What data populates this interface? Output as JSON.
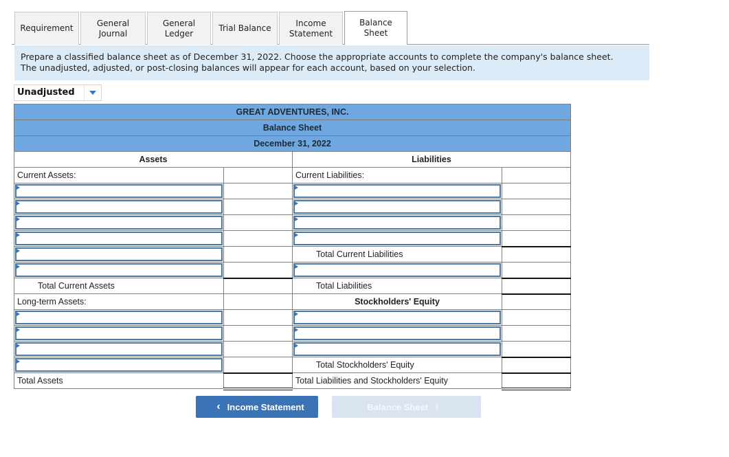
{
  "tabs": [
    {
      "label": "Requirement",
      "active": false
    },
    {
      "label": "General\nJournal",
      "active": false
    },
    {
      "label": "General\nLedger",
      "active": false
    },
    {
      "label": "Trial Balance",
      "active": false
    },
    {
      "label": "Income\nStatement",
      "active": false
    },
    {
      "label": "Balance Sheet",
      "active": true
    }
  ],
  "instructions": {
    "line1": "Prepare a classified balance sheet as of December 31, 2022. Choose the appropriate accounts to complete the company's balance sheet.",
    "line2": "The unadjusted, adjusted, or post-closing balances will appear for each account, based on your selection."
  },
  "balance_type": {
    "selected": "Unadjusted",
    "icon": "caret-down-icon"
  },
  "sheet": {
    "company": "GREAT ADVENTURES, INC.",
    "title": "Balance Sheet",
    "date": "December 31, 2022",
    "assets_header": "Assets",
    "liabilities_header": "Liabilities",
    "current_assets_label": "Current Assets:",
    "total_current_assets_label": "Total Current Assets",
    "long_term_assets_label": "Long-term Assets:",
    "total_assets_label": "Total Assets",
    "current_liabilities_label": "Current Liabilities:",
    "total_current_liabilities_label": "Total Current Liabilities",
    "total_liabilities_label": "Total Liabilities",
    "stockholders_equity_header": "Stockholders' Equity",
    "total_stockholders_equity_label": "Total Stockholders' Equity",
    "total_liabilities_and_equity_label": "Total Liabilities and Stockholders' Equity"
  },
  "nav": {
    "prev_label": "Income Statement",
    "next_label": "Balance Sheet",
    "next_disabled": true
  }
}
